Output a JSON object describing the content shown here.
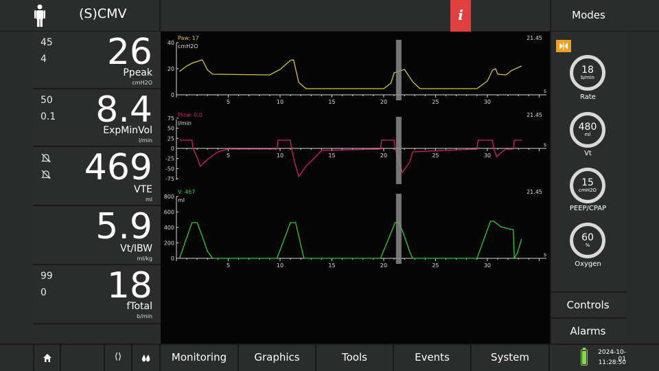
{
  "header": {
    "mode": "(S)CMV",
    "info_glyph": "i",
    "modes_label": "Modes"
  },
  "params": [
    {
      "limits": [
        "45",
        "4"
      ],
      "value": "26",
      "name": "Ppeak",
      "unit": "cmH2O"
    },
    {
      "limits": [
        "50",
        "0.1"
      ],
      "value": "8.4",
      "name": "ExpMinVol",
      "unit": "l/min"
    },
    {
      "limits": [],
      "value": "469",
      "name": "VTE",
      "unit": "ml"
    },
    {
      "limits": [],
      "value": "5.9",
      "name": "Vt/IBW",
      "unit": "ml/kg"
    },
    {
      "limits": [
        "99",
        "0"
      ],
      "value": "18",
      "name": "fTotal",
      "unit": "b/min"
    }
  ],
  "graphs": [
    {
      "label": "Paw: 17",
      "unit": "cmH2O",
      "time": "21.45",
      "yticks": [
        "40",
        "20",
        "0"
      ],
      "xticks": [
        "5",
        "10",
        "15",
        "20",
        "25",
        "30"
      ],
      "xunit": "s",
      "color": "#d8c23a"
    },
    {
      "label": "Flow: 0.0",
      "unit": "l/min",
      "time": "21.45",
      "yticks": [
        "75",
        "50",
        "25",
        "0",
        "-25",
        "-50",
        "-75"
      ],
      "xticks": [
        "5",
        "10",
        "15",
        "20",
        "25",
        "30"
      ],
      "xunit": "s",
      "color": "#d0206a"
    },
    {
      "label": "V: 467",
      "unit": "ml",
      "time": "21.45",
      "yticks": [
        "800",
        "600",
        "400",
        "200",
        "0"
      ],
      "xticks": [
        "5",
        "10",
        "15",
        "20",
        "25",
        "30"
      ],
      "xunit": "s",
      "color": "#2ecc2e"
    }
  ],
  "controls": [
    {
      "value": "18",
      "unit": "b/min",
      "name": "Rate"
    },
    {
      "value": "480",
      "unit": "ml",
      "name": "Vt"
    },
    {
      "value": "15",
      "unit": "cmH2O",
      "name": "PEEP/CPAP"
    },
    {
      "value": "60",
      "unit": "%",
      "name": "Oxygen"
    }
  ],
  "right_buttons": {
    "controls": "Controls",
    "alarms": "Alarms"
  },
  "bottom": {
    "brackets": "⟨⟩",
    "tabs": [
      "Monitoring",
      "Graphics",
      "Tools",
      "Events",
      "System"
    ],
    "date": "2024-10-01",
    "time": "11:28:50"
  }
}
